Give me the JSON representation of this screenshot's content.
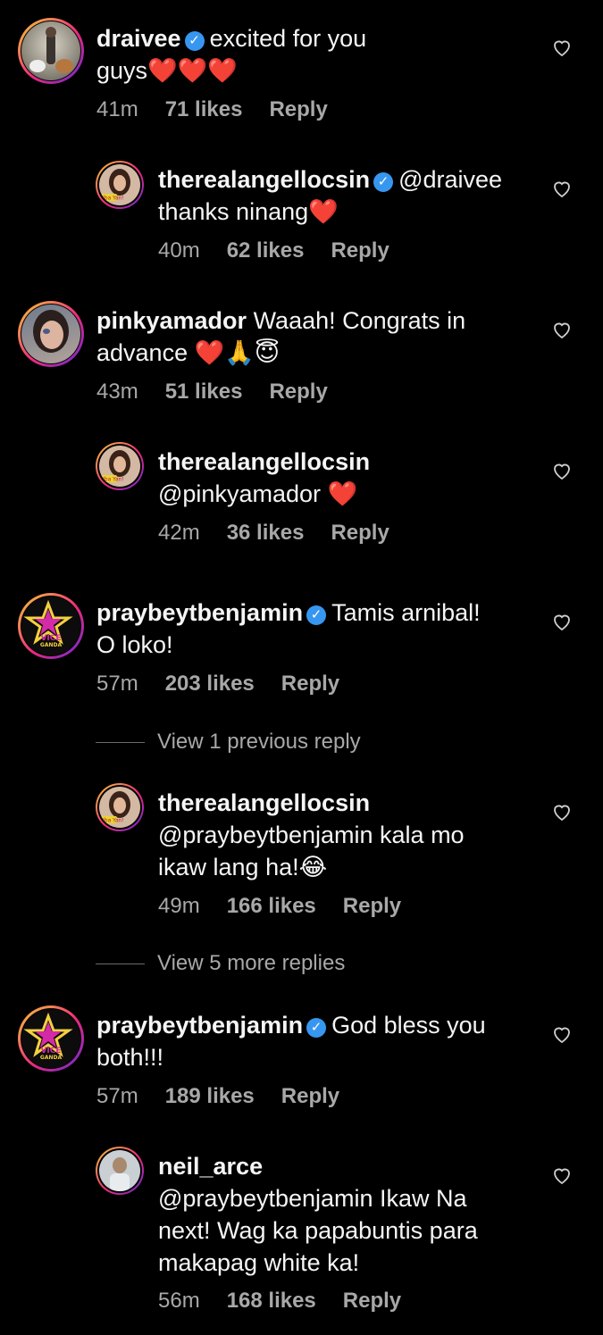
{
  "comments": [
    {
      "user": "draivee",
      "verified": true,
      "line1": "excited for you",
      "line2": "guys❤️❤️❤️",
      "time": "41m",
      "likes": "71 likes",
      "reply": "Reply"
    },
    {
      "user": "therealangellocsin",
      "verified": true,
      "line1": "@draivee",
      "line2": "thanks ninang❤️",
      "time": "40m",
      "likes": "62 likes",
      "reply": "Reply"
    },
    {
      "user": "pinkyamador",
      "verified": false,
      "line1": "Waaah! Congrats in",
      "line2": "advance ❤️🙏😇",
      "time": "43m",
      "likes": "51 likes",
      "reply": "Reply"
    },
    {
      "user": "therealangellocsin",
      "verified": false,
      "line1": "",
      "line2": "@pinkyamador ❤️",
      "time": "42m",
      "likes": "36 likes",
      "reply": "Reply"
    },
    {
      "user": "praybeytbenjamin",
      "verified": true,
      "line1": "Tamis arnibal!",
      "line2": "O loko!",
      "time": "57m",
      "likes": "203 likes",
      "reply": "Reply"
    },
    {
      "user": "therealangellocsin",
      "verified": false,
      "line1": "",
      "line2": "@praybeytbenjamin kala mo",
      "line3": "ikaw lang ha!😂",
      "time": "49m",
      "likes": "166 likes",
      "reply": "Reply"
    },
    {
      "user": "praybeytbenjamin",
      "verified": true,
      "line1": "God bless you",
      "line2": "both!!!",
      "time": "57m",
      "likes": "189 likes",
      "reply": "Reply"
    },
    {
      "user": "neil_arce",
      "verified": false,
      "line1": "",
      "line2": "@praybeytbenjamin Ikaw Na",
      "line3": "next! Wag ka papabuntis para",
      "line4": "makapag white ka!",
      "time": "56m",
      "likes": "168 likes",
      "reply": "Reply"
    }
  ],
  "view_previous": "View 1 previous reply",
  "view_more": "View 5 more replies",
  "vice_logo_text": [
    "VICE",
    "GANDA"
  ],
  "angel_badge": "Iba Yan!",
  "icons": {
    "like": "heart-outline-icon",
    "verified": "verified-badge-icon"
  },
  "colors": {
    "background": "#000000",
    "text": "#f5f5f5",
    "meta": "#a8a8a8",
    "verified": "#3797f0",
    "heart": "#e0162b"
  }
}
